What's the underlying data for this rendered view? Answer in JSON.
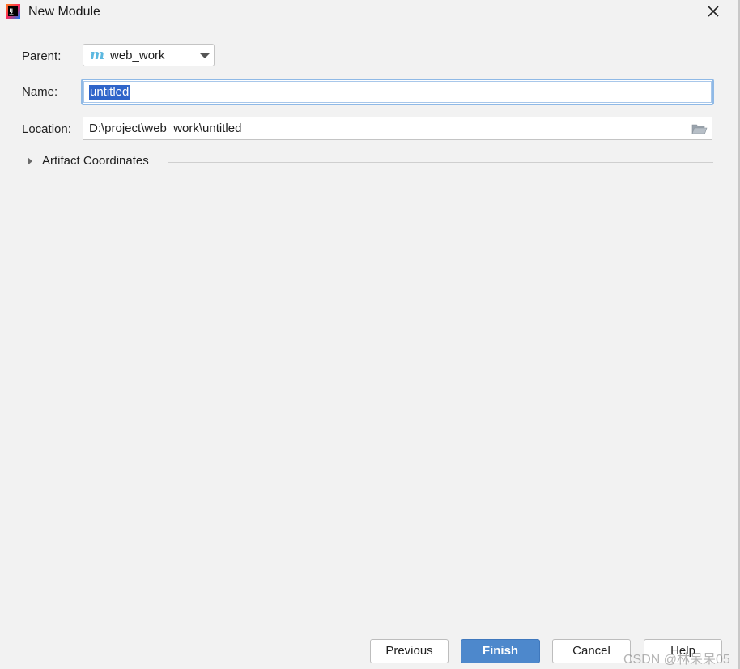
{
  "window": {
    "title": "New Module",
    "app_icon": "intellij-idea-icon",
    "close_icon": "close-icon"
  },
  "form": {
    "parent": {
      "label": "Parent:",
      "value": "web_work",
      "icon": "maven-module-icon"
    },
    "name": {
      "label": "Name:",
      "value": "untitled"
    },
    "location": {
      "label": "Location:",
      "value": "D:\\project\\web_work\\untitled",
      "browse_icon": "folder-icon"
    },
    "artifact_coordinates": {
      "label": "Artifact Coordinates",
      "expanded": false
    }
  },
  "buttons": {
    "previous": "Previous",
    "finish": "Finish",
    "cancel": "Cancel",
    "help": "Help"
  },
  "watermark": "CSDN @林呆呆05",
  "colors": {
    "background": "#f2f2f2",
    "primary_button": "#4d88cc",
    "selection": "#2f65ca",
    "focus_border": "#8fb9e6",
    "maven_icon": "#5cb8e0"
  }
}
